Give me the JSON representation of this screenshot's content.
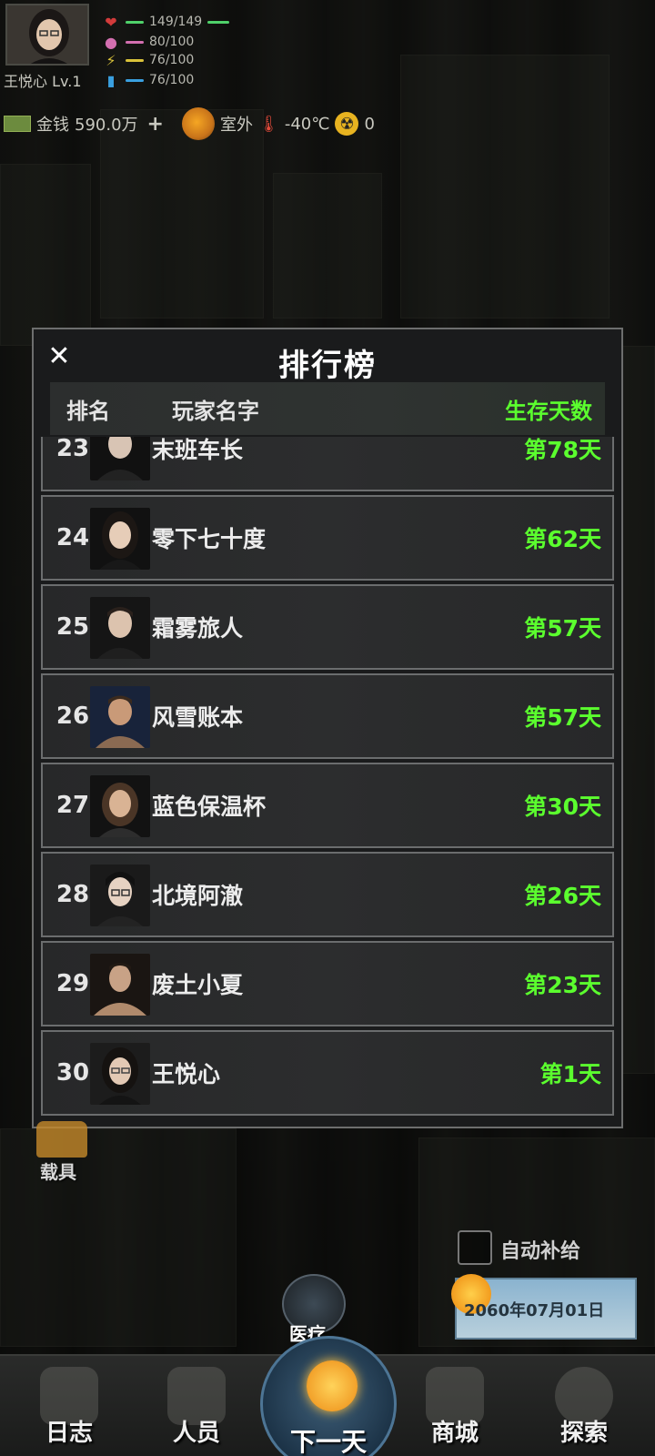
{
  "player": {
    "name": "王悦心 Lv.1",
    "stats": [
      {
        "icon": "heart-icon",
        "value": "149/149",
        "color": "#4fd16a"
      },
      {
        "icon": "stomach-icon",
        "value": "80/100",
        "color": "#d36fb0"
      },
      {
        "icon": "energy-icon",
        "value": "76/100",
        "color": "#d9c23a"
      },
      {
        "icon": "water-icon",
        "value": "76/100",
        "color": "#3aa0e0"
      }
    ],
    "money_label": "金钱",
    "money_value": "590.0万",
    "money_add": "+",
    "location": "室外",
    "temperature": "-40℃",
    "radiation": "0"
  },
  "leaderboard": {
    "title": "排行榜",
    "close": "✕",
    "columns": {
      "rank": "排名",
      "name": "玩家名字",
      "days": "生存天数"
    },
    "rows": [
      {
        "rank": "23",
        "name": "末班车长",
        "days": "第78天"
      },
      {
        "rank": "24",
        "name": "零下七十度",
        "days": "第62天"
      },
      {
        "rank": "25",
        "name": "霜雾旅人",
        "days": "第57天"
      },
      {
        "rank": "26",
        "name": "风雪账本",
        "days": "第57天"
      },
      {
        "rank": "27",
        "name": "蓝色保温杯",
        "days": "第30天"
      },
      {
        "rank": "28",
        "name": "北境阿澈",
        "days": "第26天"
      },
      {
        "rank": "29",
        "name": "废土小夏",
        "days": "第23天"
      },
      {
        "rank": "30",
        "name": "王悦心",
        "days": "第1天"
      }
    ]
  },
  "side": {
    "auto_supply": "自动补给",
    "date": "2060年07月01日",
    "vehicle": "载具",
    "medical": "医疗"
  },
  "nav": {
    "log": "日志",
    "people": "人员",
    "next_day": "下一天",
    "shop": "商城",
    "explore": "探索"
  },
  "colors": {
    "accent_green": "#5bff2e"
  }
}
